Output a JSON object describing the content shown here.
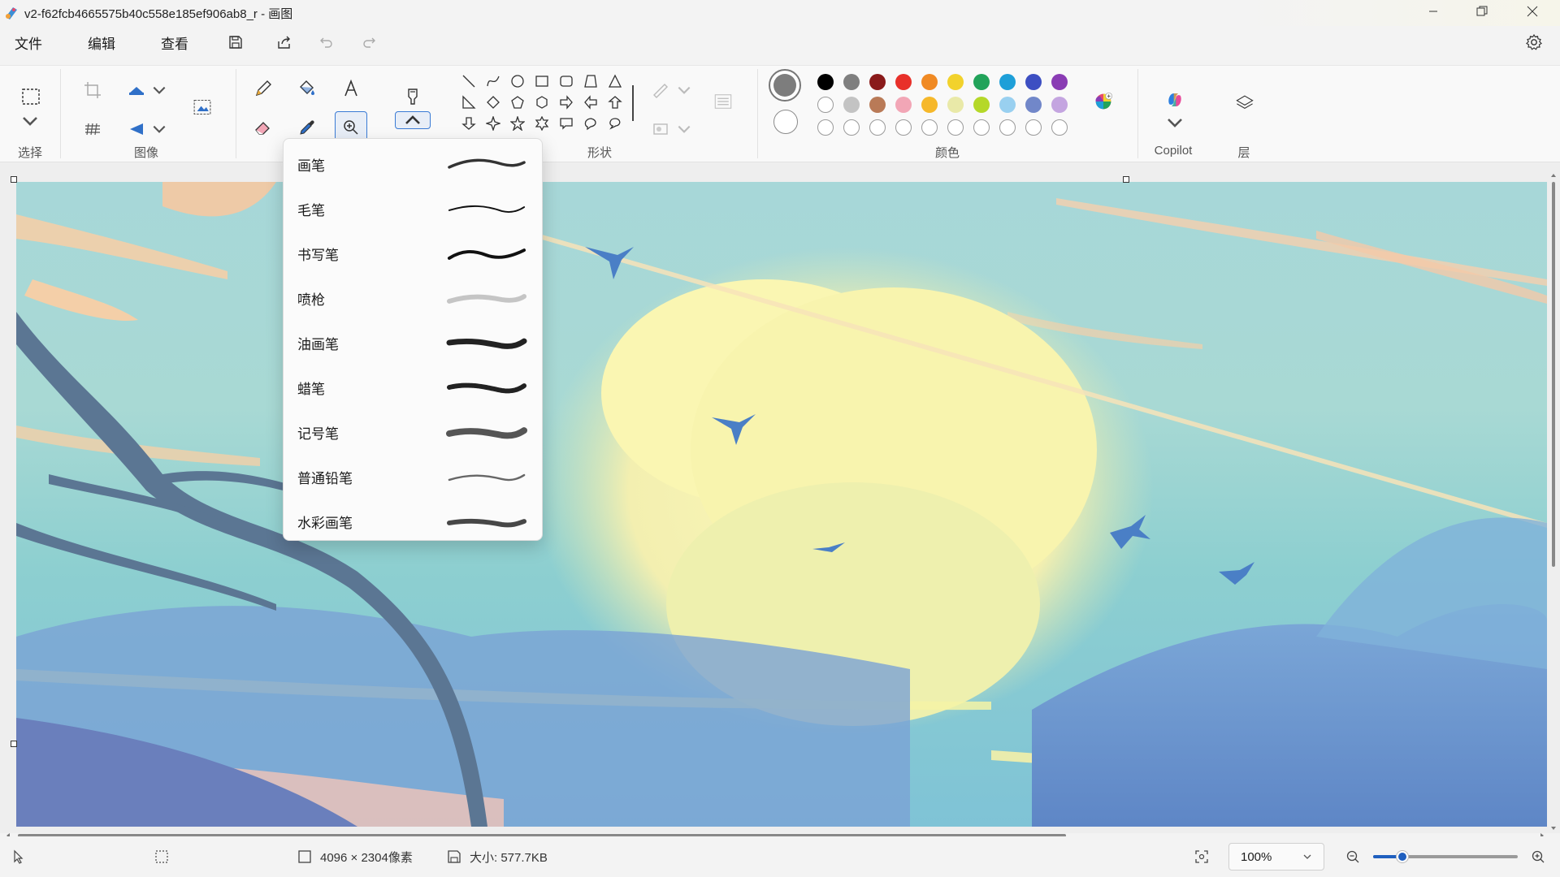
{
  "titlebar": {
    "title": "v2-f62fcb4665575b40c558e185ef906ab8_r - 画图"
  },
  "menu": {
    "file": "文件",
    "edit": "编辑",
    "view": "查看"
  },
  "ribbon": {
    "groups": {
      "select": "选择",
      "image": "图像",
      "shapes": "形状",
      "colors": "颜色",
      "copilot": "Copilot",
      "layers": "层"
    },
    "colors": {
      "primary": "#7d7d7d",
      "secondary": "#ffffff",
      "row1": [
        "#000000",
        "#7f7f7f",
        "#8a1a1a",
        "#e8302a",
        "#f08a24",
        "#f2d22c",
        "#22a35a",
        "#1e9fd8",
        "#3d4fc2",
        "#8a3cb4"
      ],
      "row2": [
        "#ffffff",
        "#c3c3c3",
        "#b97a57",
        "#f2a6b6",
        "#f6b82a",
        "#e9e9a8",
        "#b5d829",
        "#99d0f0",
        "#7187c9",
        "#c4a5e0"
      ]
    }
  },
  "brushes": {
    "items": [
      {
        "label": "画笔",
        "stroke": "brush"
      },
      {
        "label": "毛笔",
        "stroke": "calligraphy"
      },
      {
        "label": "书写笔",
        "stroke": "writing-pen"
      },
      {
        "label": "喷枪",
        "stroke": "airbrush"
      },
      {
        "label": "油画笔",
        "stroke": "oil-brush"
      },
      {
        "label": "蜡笔",
        "stroke": "crayon"
      },
      {
        "label": "记号笔",
        "stroke": "marker"
      },
      {
        "label": "普通铅笔",
        "stroke": "pencil"
      },
      {
        "label": "水彩画笔",
        "stroke": "watercolor"
      }
    ]
  },
  "status": {
    "dimensions": "4096 × 2304像素",
    "size": "大小: 577.7KB",
    "zoom": "100%",
    "zoom_slider_fraction": 0.2
  }
}
